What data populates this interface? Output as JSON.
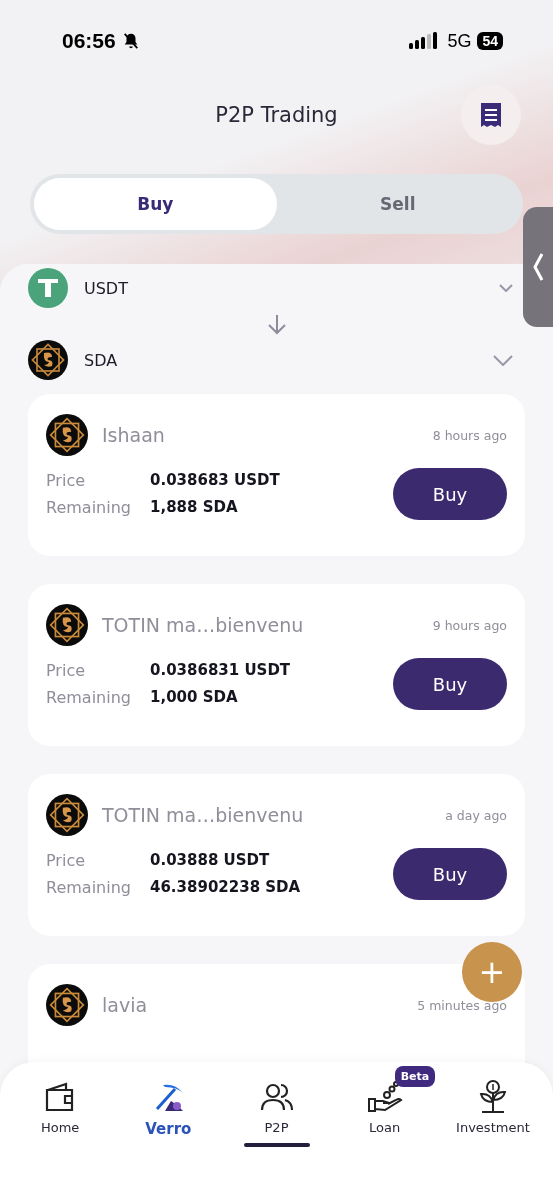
{
  "status_bar": {
    "time": "06:56",
    "network": "5G",
    "battery": "54"
  },
  "header": {
    "title": "P2P Trading"
  },
  "tabs": [
    {
      "label": "Buy",
      "selected": true
    },
    {
      "label": "Sell",
      "selected": false
    }
  ],
  "pair": {
    "from": "USDT",
    "to": "SDA"
  },
  "offers": [
    {
      "user": "Ishaan",
      "time": "8 hours ago",
      "price_label": "Price",
      "price": "0.038683 USDT",
      "remaining_label": "Remaining",
      "remaining": "1,888 SDA",
      "action": "Buy"
    },
    {
      "user": "TOTIN ma…bienvenu",
      "time": "9 hours ago",
      "price_label": "Price",
      "price": "0.0386831 USDT",
      "remaining_label": "Remaining",
      "remaining": "1,000 SDA",
      "action": "Buy"
    },
    {
      "user": "TOTIN ma…bienvenu",
      "time": "a day ago",
      "price_label": "Price",
      "price": "0.03888 USDT",
      "remaining_label": "Remaining",
      "remaining": "46.38902238 SDA",
      "action": "Buy"
    },
    {
      "user": "lavia",
      "time": "5 minutes ago"
    }
  ],
  "fab": "+",
  "nav": [
    {
      "label": "Home",
      "kind": "plain",
      "selected": false
    },
    {
      "label": "Verro",
      "kind": "brand",
      "selected": false
    },
    {
      "label": "P2P",
      "kind": "plain",
      "selected": true
    },
    {
      "label": "Loan",
      "kind": "plain",
      "selected": false,
      "badge": "Beta"
    },
    {
      "label": "Investment",
      "kind": "plain",
      "selected": false
    }
  ]
}
